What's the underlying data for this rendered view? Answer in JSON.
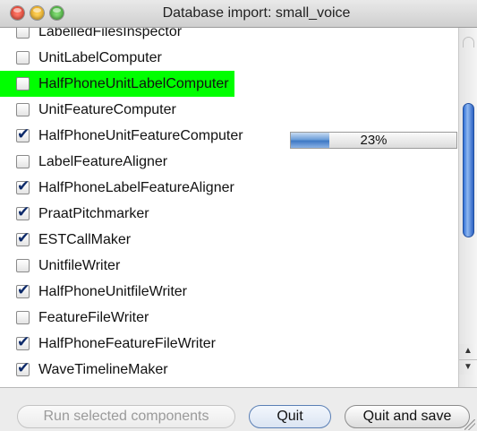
{
  "window": {
    "title": "Database import: small_voice"
  },
  "components": [
    {
      "label": "LabelledFilesInspector",
      "checked": false
    },
    {
      "label": "UnitLabelComputer",
      "checked": false
    },
    {
      "label": "HalfPhoneUnitLabelComputer",
      "checked": false,
      "active": true
    },
    {
      "label": "UnitFeatureComputer",
      "checked": false
    },
    {
      "label": "HalfPhoneUnitFeatureComputer",
      "checked": true
    },
    {
      "label": "LabelFeatureAligner",
      "checked": false
    },
    {
      "label": "HalfPhoneLabelFeatureAligner",
      "checked": true
    },
    {
      "label": "PraatPitchmarker",
      "checked": true
    },
    {
      "label": "ESTCallMaker",
      "checked": true
    },
    {
      "label": "UnitfileWriter",
      "checked": false
    },
    {
      "label": "HalfPhoneUnitfileWriter",
      "checked": true
    },
    {
      "label": "FeatureFileWriter",
      "checked": false
    },
    {
      "label": "HalfPhoneFeatureFileWriter",
      "checked": true
    },
    {
      "label": "WaveTimelineMaker",
      "checked": true
    }
  ],
  "progress": {
    "value": 0.23,
    "text": "23%"
  },
  "buttons": {
    "run": "Run selected components",
    "quit": "Quit",
    "quit_save": "Quit and save"
  },
  "colors": {
    "active_highlight": "#00ff00",
    "progress_blue": "#3f78c4"
  }
}
